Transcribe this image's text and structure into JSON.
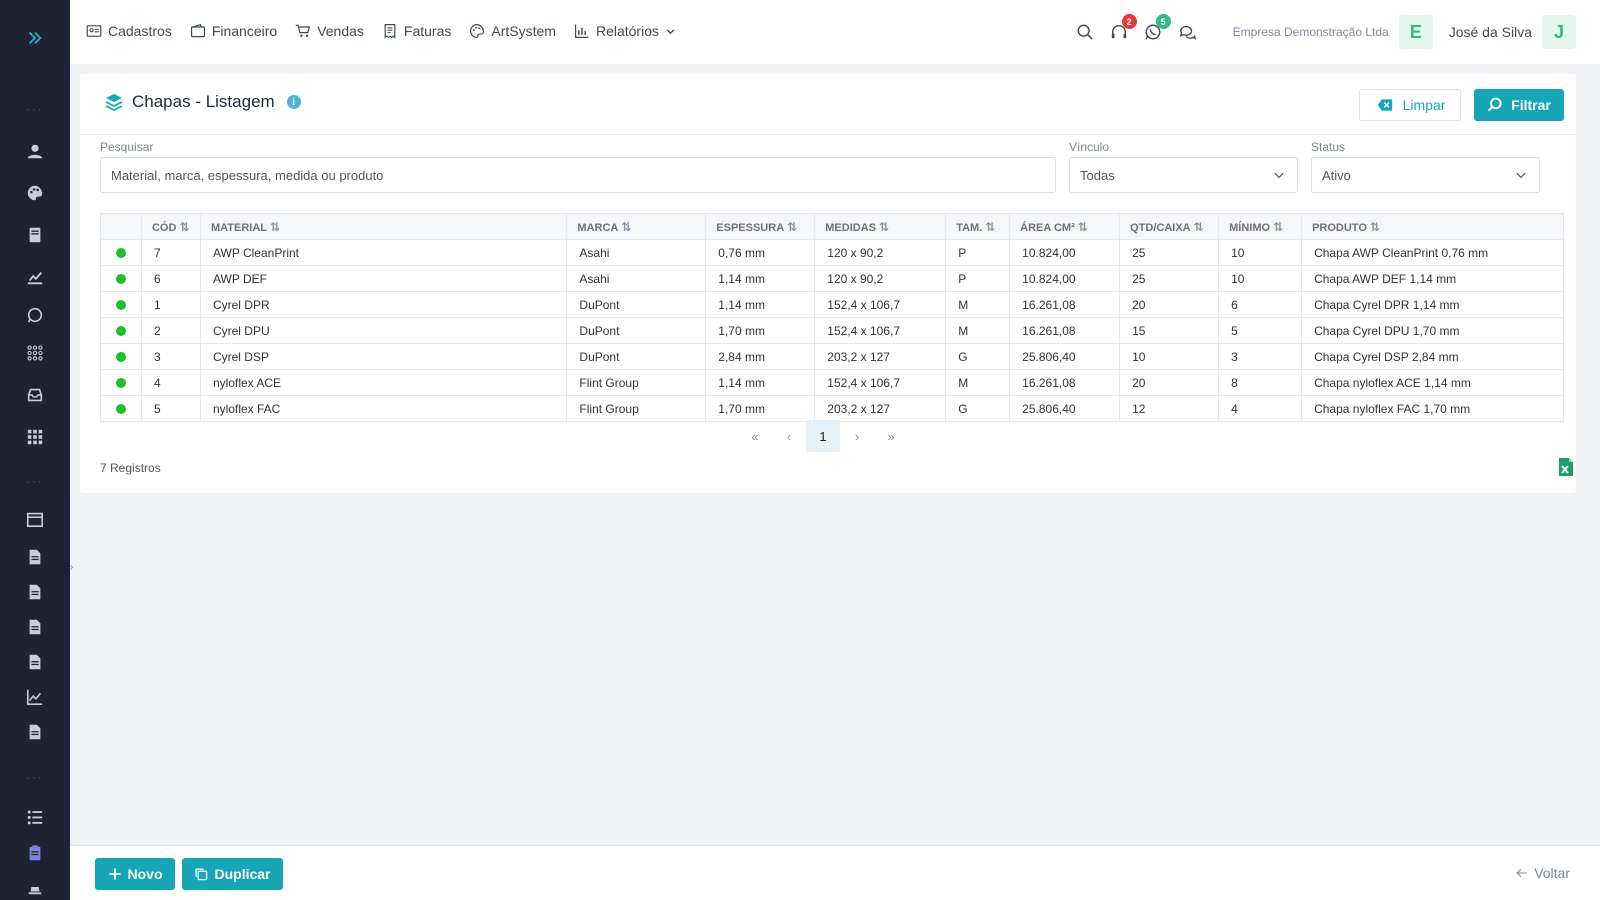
{
  "colors": {
    "accent": "#16a6b6",
    "sidebar": "#1e2233",
    "active_dot": "#1fbf2f",
    "badge_red": "#e53935",
    "badge_green": "#2dbd7f"
  },
  "nav": [
    {
      "label": "Cadastros",
      "icon": "id-card-icon"
    },
    {
      "label": "Financeiro",
      "icon": "wallet-icon"
    },
    {
      "label": "Vendas",
      "icon": "cart-icon"
    },
    {
      "label": "Faturas",
      "icon": "receipt-icon"
    },
    {
      "label": "ArtSystem",
      "icon": "palette-icon"
    },
    {
      "label": "Relatórios",
      "icon": "chart-icon"
    }
  ],
  "top_right": {
    "support_badge": "2",
    "whatsapp_badge": "5",
    "company": "Empresa Demonstração Ltda",
    "company_initial": "E",
    "user": "José da Silva",
    "user_initial": "J"
  },
  "page": {
    "title": "Chapas - Listagem",
    "clear_label": "Limpar",
    "filter_label": "Filtrar"
  },
  "filters": {
    "search_label": "Pesquisar",
    "search_placeholder": "Material, marca, espessura, medida ou produto",
    "vinculo_label": "Vínculo",
    "vinculo_value": "Todas",
    "status_label": "Status",
    "status_value": "Ativo"
  },
  "table": {
    "headers": [
      "CÓD",
      "MATERIAL",
      "MARCA",
      "ESPESSURA",
      "MEDIDAS",
      "TAM.",
      "ÁREA CM²",
      "QTD/CAIXA",
      "MÍNIMO",
      "PRODUTO"
    ],
    "rows": [
      [
        "7",
        "AWP CleanPrint",
        "Asahi",
        "0,76 mm",
        "120 x 90,2",
        "P",
        "10.824,00",
        "25",
        "10",
        "Chapa AWP CleanPrint 0,76 mm"
      ],
      [
        "6",
        "AWP DEF",
        "Asahi",
        "1,14 mm",
        "120 x 90,2",
        "P",
        "10.824,00",
        "25",
        "10",
        "Chapa AWP DEF 1,14 mm"
      ],
      [
        "1",
        "Cyrel DPR",
        "DuPont",
        "1,14 mm",
        "152,4 x 106,7",
        "M",
        "16.261,08",
        "20",
        "6",
        "Chapa Cyrel DPR 1,14 mm"
      ],
      [
        "2",
        "Cyrel DPU",
        "DuPont",
        "1,70 mm",
        "152,4 x 106,7",
        "M",
        "16.261,08",
        "15",
        "5",
        "Chapa Cyrel DPU 1,70 mm"
      ],
      [
        "3",
        "Cyrel DSP",
        "DuPont",
        "2,84 mm",
        "203,2 x 127",
        "G",
        "25.806,40",
        "10",
        "3",
        "Chapa Cyrel DSP 2,84 mm"
      ],
      [
        "4",
        "nyloflex ACE",
        "Flint Group",
        "1,14 mm",
        "152,4 x 106,7",
        "M",
        "16.261,08",
        "20",
        "8",
        "Chapa nyloflex ACE 1,14 mm"
      ],
      [
        "5",
        "nyloflex FAC",
        "Flint Group",
        "1,70 mm",
        "203,2 x 127",
        "G",
        "25.806,40",
        "12",
        "4",
        "Chapa nyloflex FAC 1,70 mm"
      ]
    ]
  },
  "pagination": {
    "first": "«",
    "prev": "‹",
    "current": "1",
    "next": "›",
    "last": "»"
  },
  "records": "7 Registros",
  "footer": {
    "new_label": "Novo",
    "duplicate_label": "Duplicar",
    "back_label": "Voltar"
  }
}
